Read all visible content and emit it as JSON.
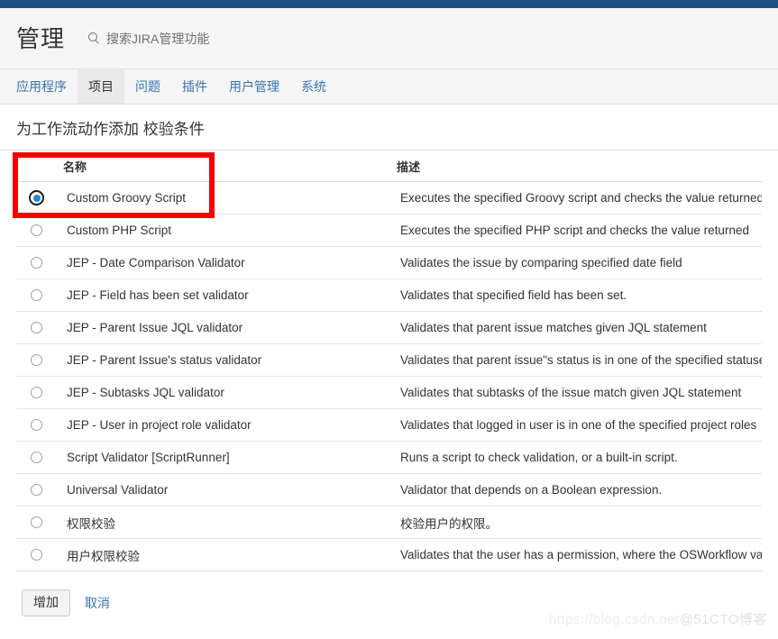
{
  "header": {
    "title": "管理",
    "search_icon": "search-icon",
    "search_placeholder": "搜索JIRA管理功能"
  },
  "nav": {
    "tabs": [
      {
        "label": "应用程序",
        "active": false
      },
      {
        "label": "项目",
        "active": true
      },
      {
        "label": "问题",
        "active": false
      },
      {
        "label": "插件",
        "active": false
      },
      {
        "label": "用户管理",
        "active": false
      },
      {
        "label": "系统",
        "active": false
      }
    ]
  },
  "page": {
    "title": "为工作流动作添加 校验条件"
  },
  "table": {
    "columns": [
      "名称",
      "描述"
    ],
    "rows": [
      {
        "name": "Custom Groovy Script",
        "desc": "Executes the specified Groovy script and checks the value returned",
        "selected": true
      },
      {
        "name": "Custom PHP Script",
        "desc": "Executes the specified PHP script and checks the value returned",
        "selected": false
      },
      {
        "name": "JEP - Date Comparison Validator",
        "desc": "Validates the issue by comparing specified date field",
        "selected": false
      },
      {
        "name": "JEP - Field has been set validator",
        "desc": "Validates that specified field has been set.",
        "selected": false
      },
      {
        "name": "JEP - Parent Issue JQL validator",
        "desc": "Validates that parent issue matches given JQL statement",
        "selected": false
      },
      {
        "name": "JEP - Parent Issue's status validator",
        "desc": "Validates that parent issue\"s status is in one of the specified statuses",
        "selected": false
      },
      {
        "name": "JEP - Subtasks JQL validator",
        "desc": "Validates that subtasks of the issue match given JQL statement",
        "selected": false
      },
      {
        "name": "JEP - User in project role validator",
        "desc": "Validates that logged in user is in one of the specified project roles",
        "selected": false
      },
      {
        "name": "Script Validator [ScriptRunner]",
        "desc": "Runs a script to check validation, or a built-in script.",
        "selected": false
      },
      {
        "name": "Universal Validator",
        "desc": "Validator that depends on a Boolean expression.",
        "selected": false
      },
      {
        "name": "权限校验",
        "desc": "校验用户的权限。",
        "selected": false
      },
      {
        "name": "用户权限校验",
        "desc": "Validates that the user has a permission, where the OSWorkflow variable",
        "selected": false
      }
    ]
  },
  "actions": {
    "add_label": "增加",
    "cancel_label": "取消"
  },
  "annotation": {
    "color": "#f50000"
  },
  "watermark": {
    "url": "https://blog.csdn.net",
    "tag": "@51CTO博客"
  }
}
